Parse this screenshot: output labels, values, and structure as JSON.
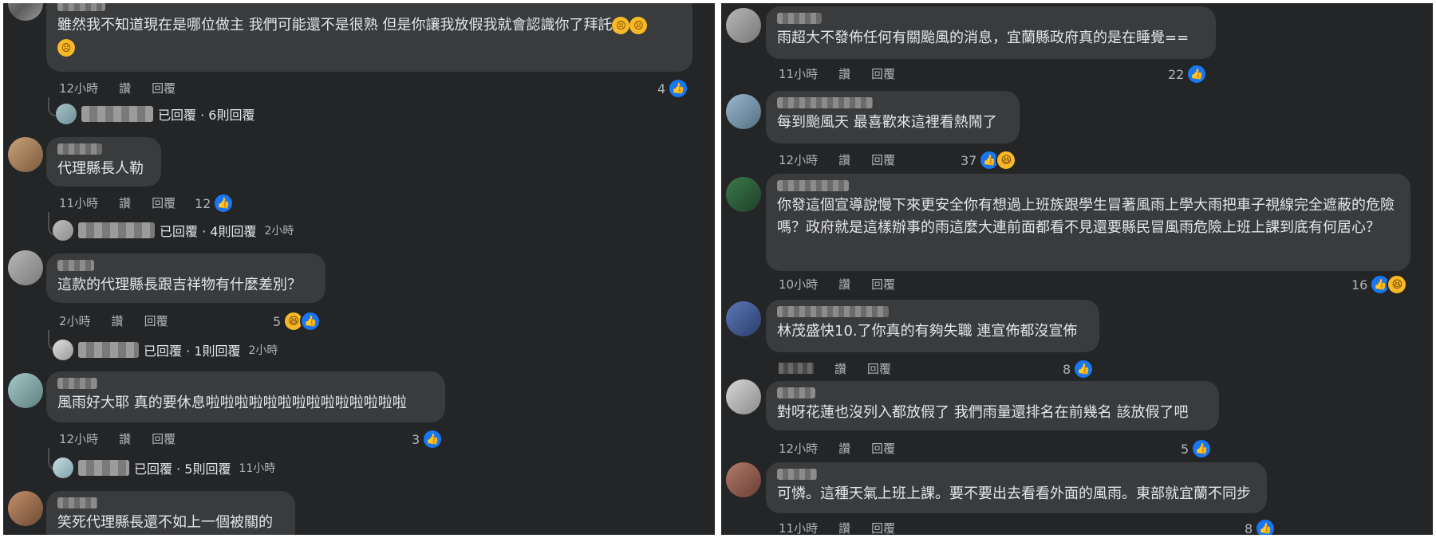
{
  "labels": {
    "like": "讚",
    "reply": "回覆"
  },
  "left": [
    {
      "text": "雖然我不知道現在是哪位做主 我們可能還不是很熟 但是你讓我放假我就會認識你了拜託",
      "emoji_suffix": "sad-face x3",
      "time": "12小時",
      "count": "4",
      "reactions": [
        "like"
      ],
      "replies": {
        "summary": "已回覆 · 6則回覆",
        "time": ""
      }
    },
    {
      "text": "代理縣長人勒",
      "time": "11小時",
      "count": "12",
      "reactions": [
        "like"
      ],
      "replies": {
        "summary": "已回覆 · 4則回覆",
        "time": "2小時"
      }
    },
    {
      "text": "這款的代理縣長跟吉祥物有什麼差別？",
      "time": "2小時",
      "count": "5",
      "reactions": [
        "haha",
        "like"
      ],
      "replies": {
        "summary": "已回覆 · 1則回覆",
        "time": "2小時"
      }
    },
    {
      "text": "風雨好大耶 真的要休息啦啦啦啦啦啦啦啦啦啦啦啦啦啦",
      "time": "12小時",
      "count": "3",
      "reactions": [
        "like"
      ],
      "replies": {
        "summary": "已回覆 · 5則回覆",
        "time": "11小時"
      }
    },
    {
      "text": "笑死代理縣長還不如上一個被關的"
    }
  ],
  "right": [
    {
      "text": "雨超大不發佈任何有關颱風的消息，宜蘭縣政府真的是在睡覺==",
      "time": "11小時",
      "count": "22",
      "reactions": [
        "like"
      ]
    },
    {
      "text": "每到颱風天 最喜歡來這裡看熱鬧了",
      "time": "12小時",
      "count": "37",
      "reactions": [
        "like",
        "haha"
      ]
    },
    {
      "text": "你發這個宣導說慢下來更安全你有想過上班族跟學生冒著風雨上學大雨把車子視線完全遮蔽的危險嗎？政府就是這樣辦事的雨這麼大連前面都看不見還要縣民冒風雨危險上班上課到底有何居心？",
      "time": "10小時",
      "count": "16",
      "reactions": [
        "like",
        "haha"
      ]
    },
    {
      "text": "林茂盛快10.了你真的有夠失職 連宣佈都沒宣佈",
      "time": "",
      "count": "8",
      "reactions": [
        "like"
      ]
    },
    {
      "text": "對呀花蓮也沒列入都放假了 我們雨量還排名在前幾名 該放假了吧",
      "time": "12小時",
      "count": "5",
      "reactions": [
        "like"
      ]
    },
    {
      "text": "可憐。這種天氣上班上課。要不要出去看看外面的風雨。東部就宜蘭不同步",
      "time": "11小時",
      "count": "8",
      "reactions": [
        "like"
      ]
    }
  ],
  "icons": {
    "like": "thumbs-up-icon",
    "haha": "haha-emoji-icon",
    "sad": "sad-emoji-icon"
  }
}
